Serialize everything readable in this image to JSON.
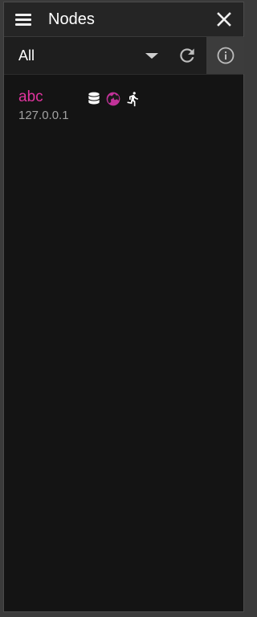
{
  "header": {
    "title": "Nodes"
  },
  "toolbar": {
    "filter_value": "All"
  },
  "nodes": [
    {
      "name": "abc",
      "address": "127.0.0.1",
      "status_icons": [
        "database-icon",
        "globe-icon",
        "running-person-icon"
      ]
    }
  ],
  "colors": {
    "accent": "#e0349e",
    "background": "#141414",
    "titlebar": "#252525",
    "info_button_bg": "#3c3c3c"
  }
}
